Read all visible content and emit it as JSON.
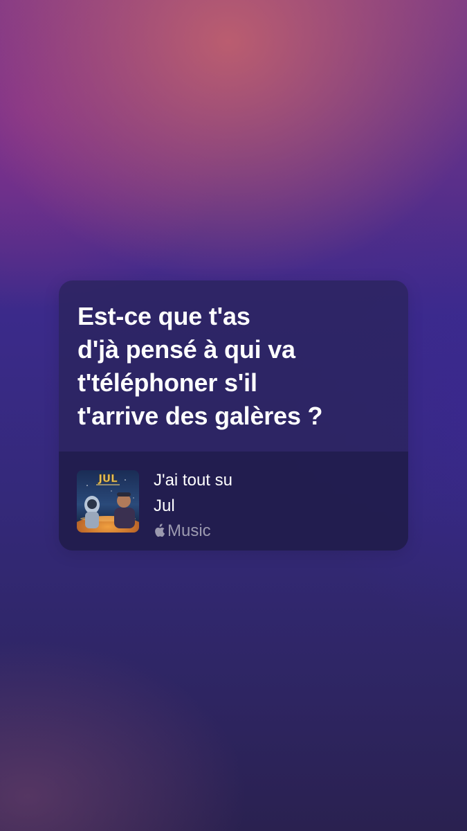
{
  "lyric_card": {
    "lines": [
      "Est-ce que t'as",
      "d'jà pensé à qui va",
      "t'téléphoner s'il",
      "t'arrive des galères ?"
    ]
  },
  "track": {
    "album_art_label": "JUL",
    "title": "J'ai tout su",
    "artist": "Jul",
    "service_icon": "apple-logo-icon",
    "service_label": "Music"
  },
  "colors": {
    "card_background": "#2a245c",
    "text_primary": "#ffffff",
    "text_secondary": "#8c89a8"
  }
}
